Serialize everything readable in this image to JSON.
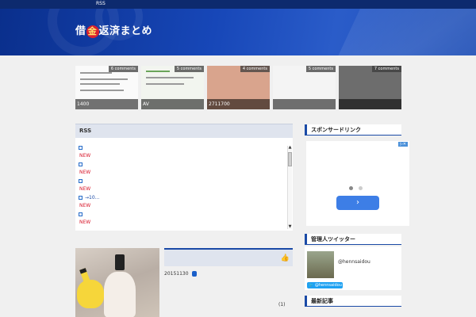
{
  "topbar": {
    "rss": "RSS"
  },
  "header": {
    "title_pre": "借",
    "title_mark": "金",
    "title_post": "返済まとめ"
  },
  "thumbnails": [
    {
      "comments": "6 comments",
      "caption": "1400"
    },
    {
      "comments": "5 comments",
      "caption": "AV"
    },
    {
      "comments": "4 comments",
      "caption": "2711700"
    },
    {
      "comments": "5 comments",
      "caption": ""
    },
    {
      "comments": "7 comments",
      "caption": ""
    }
  ],
  "rss_box": {
    "title": "RSS",
    "items": [
      {
        "text": "",
        "new": "NEW"
      },
      {
        "text": "",
        "new": "NEW"
      },
      {
        "text": "",
        "new": "NEW"
      },
      {
        "text": "→10...",
        "new": "NEW"
      },
      {
        "text": "",
        "new": "NEW"
      }
    ]
  },
  "post": {
    "date": "20151130",
    "count": "(1)"
  },
  "sidebar": {
    "ad_heading": "スポンサードリンク",
    "ad_button": "›",
    "twitter_heading": "管理人ツイッター",
    "twitter_name": "@hennsaidou",
    "twitter_follow": "@hennsaidou",
    "heading3": "最新記事"
  },
  "colors": {
    "accent": "#1a4aa6",
    "header_bg": "#1747b8",
    "new": "#d8182b",
    "twitter": "#1da1f2"
  }
}
